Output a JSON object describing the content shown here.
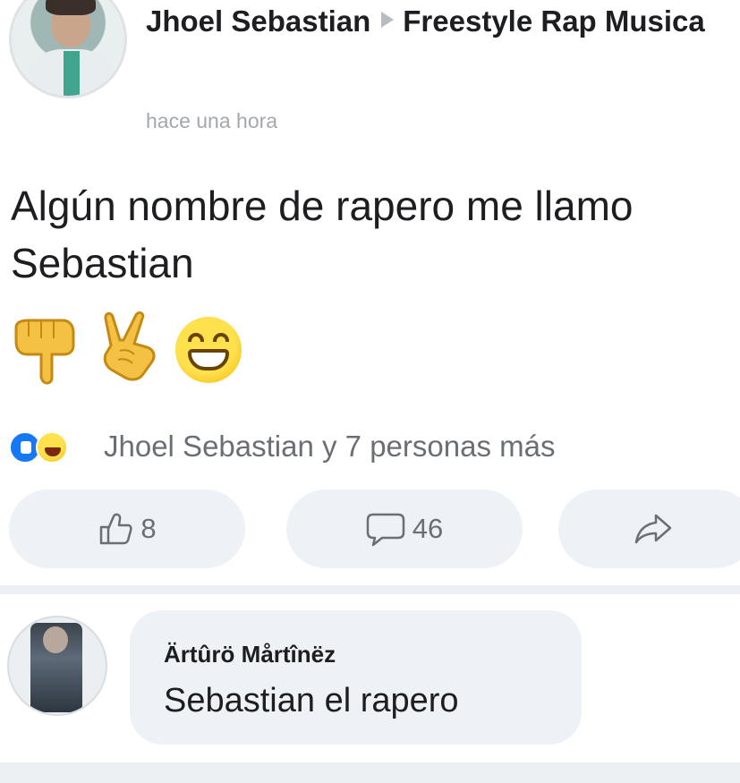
{
  "post": {
    "author": "Jhoel Sebastian",
    "group": "Freestyle Rap Musica",
    "time": "hace una hora",
    "text": "Algún nombre de rapero me llamo Sebastian",
    "emojis": [
      "point-down-icon",
      "rock-horns-icon",
      "grinning-face-icon"
    ]
  },
  "reactions": {
    "icons": [
      "like-icon",
      "haha-icon"
    ],
    "summary": "Jhoel Sebastian y 7 personas más"
  },
  "actions": {
    "like_count": "8",
    "comment_count": "46",
    "share_icon": "share-arrow-icon"
  },
  "comment": {
    "author": "Ärtûrö Mårtînëz",
    "text": "Sebastian el rapero"
  },
  "colors": {
    "like_blue": "#1877f2",
    "bubble_bg": "#eef1f5",
    "muted_text": "#6b6f75"
  }
}
